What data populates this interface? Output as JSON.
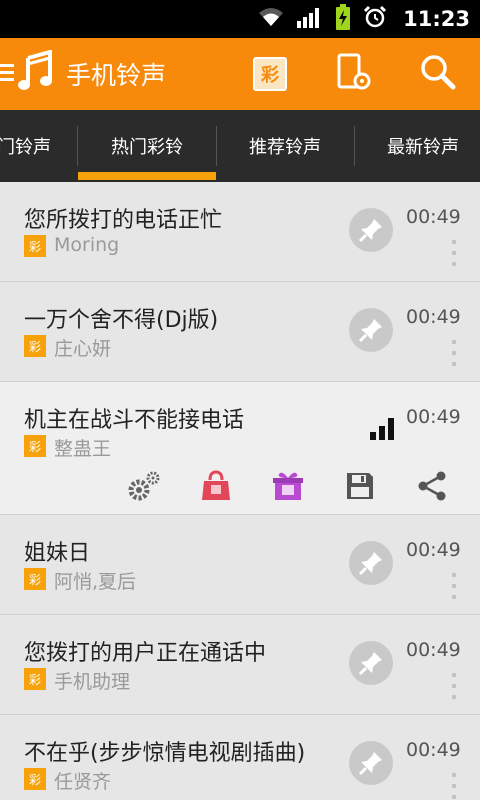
{
  "status_bar": {
    "time": "11:23"
  },
  "app_bar": {
    "title": "手机铃声",
    "caiyin_label": "彩"
  },
  "tabs": [
    {
      "label": "门铃声"
    },
    {
      "label": "热门彩铃"
    },
    {
      "label": "推荐铃声"
    },
    {
      "label": "最新铃声"
    }
  ],
  "active_tab_index": 1,
  "badge_label": "彩",
  "songs": [
    {
      "title": "您所拨打的电话正忙",
      "artist": "Moring",
      "duration": "00:49"
    },
    {
      "title": "一万个舍不得(Dj版)",
      "artist": "庄心妍",
      "duration": "00:49"
    },
    {
      "title": "机主在战斗不能接电话",
      "artist": "整蛊王",
      "duration": "00:49"
    },
    {
      "title": "姐妹日",
      "artist": "阿悄,夏后",
      "duration": "00:49"
    },
    {
      "title": "您拨打的用户正在通话中",
      "artist": "手机助理",
      "duration": "00:49"
    },
    {
      "title": "不在乎(步步惊情电视剧插曲)",
      "artist": "任贤齐",
      "duration": "00:49"
    }
  ],
  "expanded_row_index": 2,
  "expanded_actions": [
    "settings-icon",
    "ringtone-bag-icon",
    "gift-icon",
    "save-icon",
    "share-icon"
  ],
  "colors": {
    "accent": "#f7890b",
    "tab_indicator": "#f7a20b",
    "badge": "#f7a20b",
    "tab_bg": "#2b2b2b"
  }
}
